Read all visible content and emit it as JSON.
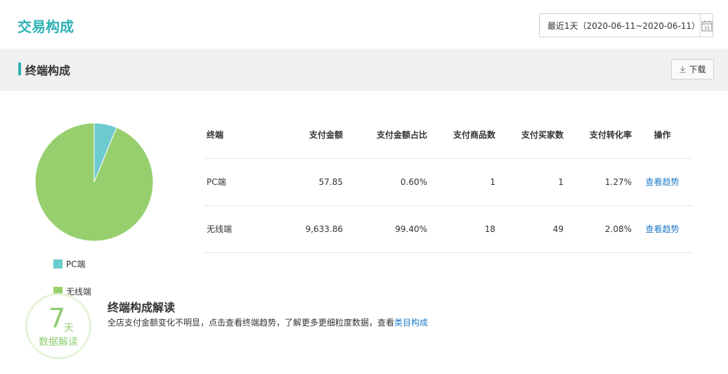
{
  "header": {
    "title": "交易构成"
  },
  "date_range": {
    "label": "最近1天（2020-06-11~2020-06-11）",
    "calendar_day": "15"
  },
  "section": {
    "title": "终端构成",
    "download_label": "下载"
  },
  "colors": {
    "accent": "#2eb2b5",
    "pc": "#6ccbcf",
    "wireless": "#98cf6e",
    "link": "#1e79c8"
  },
  "chart_data": {
    "type": "pie",
    "slices": [
      {
        "name": "PC端",
        "value": 0.6
      },
      {
        "name": "无线端",
        "value": 99.4
      }
    ],
    "legend": "bottom-left"
  },
  "legend": [
    {
      "label": "PC端"
    },
    {
      "label": "无线端"
    }
  ],
  "table": {
    "headers": [
      "终端",
      "支付金额",
      "支付金额占比",
      "支付商品数",
      "支付买家数",
      "支付转化率",
      "操作"
    ],
    "rows": [
      {
        "terminal": "PC端",
        "amount": "57.85",
        "share": "0.60%",
        "items": "1",
        "buyers": "1",
        "rate": "1.27%",
        "action": "查看趋势"
      },
      {
        "terminal": "无线端",
        "amount": "9,633.86",
        "share": "99.40%",
        "items": "18",
        "buyers": "49",
        "rate": "2.08%",
        "action": "查看趋势"
      }
    ]
  },
  "interpretation": {
    "badge_number": "7",
    "badge_unit": "天",
    "badge_label": "数据解读",
    "title": "终端构成解读",
    "text": "全店支付金额变化不明显，点击查看终端趋势，了解更多更细粒度数据，查看",
    "link": "类目构成"
  }
}
